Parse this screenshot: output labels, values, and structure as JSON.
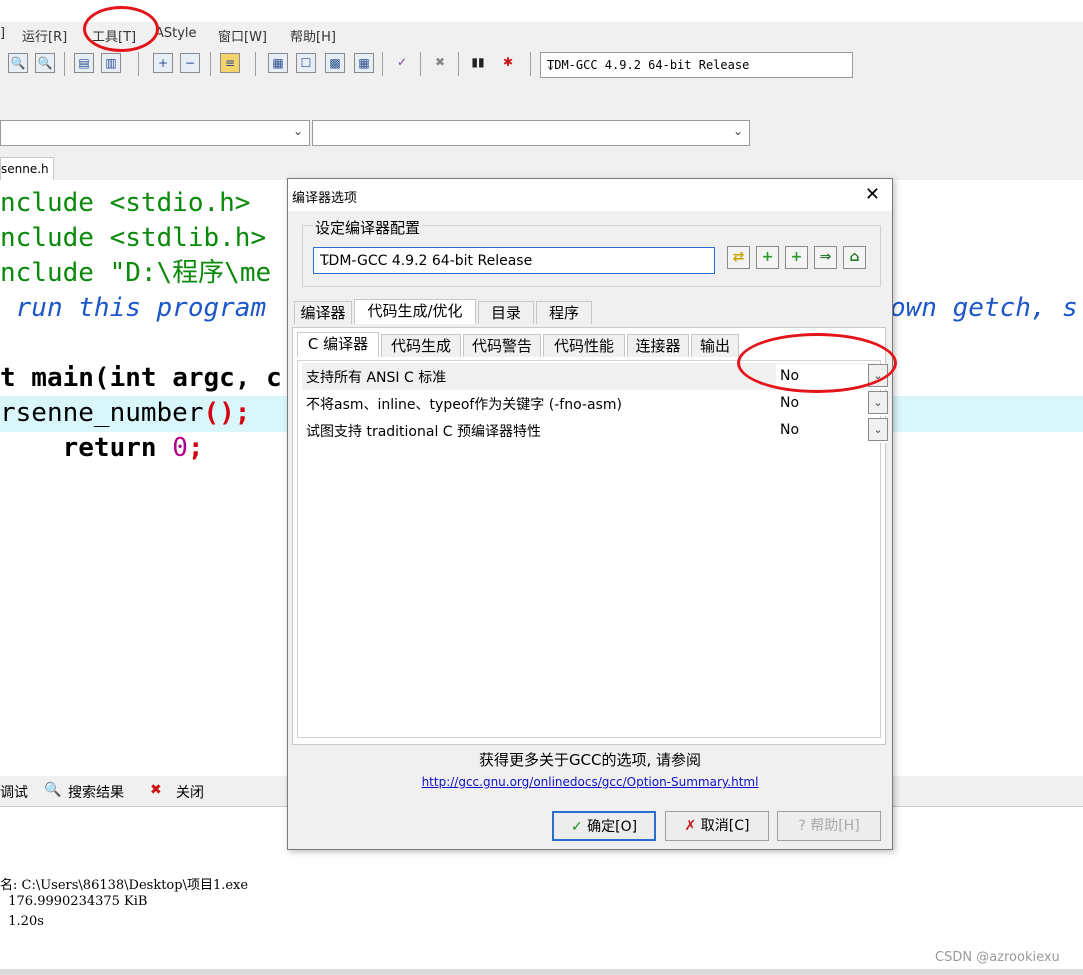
{
  "menu": {
    "items": [
      "]",
      "运行[R]",
      "工具[T]",
      "AStyle",
      "窗口[W]",
      "帮助[H]"
    ]
  },
  "toolbar": {
    "compiler": "TDM-GCC 4.9.2 64-bit Release"
  },
  "file_tab": "senne.h",
  "editor": {
    "lines": [
      "nclude <stdio.h>",
      "nclude <stdlib.h>",
      "nclude \"D:\\程序\\me",
      " run this program ",
      "own getch, s",
      "t main(",
      "int",
      " argc, c",
      "rsenne_number",
      "();",
      "    return ",
      "0",
      ";"
    ]
  },
  "dialog": {
    "title": "编译器选项",
    "group_label": "设定编译器配置",
    "config_value": "TDM-GCC 4.9.2 64-bit Release",
    "tabs": [
      "编译器",
      "代码生成/优化",
      "目录",
      "程序"
    ],
    "subtabs": [
      "C 编译器",
      "代码生成",
      "代码警告",
      "代码性能",
      "连接器",
      "输出"
    ],
    "options": [
      {
        "label": "支持所有 ANSI C 标准",
        "value": "No"
      },
      {
        "label": "不将asm、inline、typeof作为关键字 (-fno-asm)",
        "value": "No"
      },
      {
        "label": "试图支持 traditional C 预编译器特性",
        "value": "No"
      }
    ],
    "more_info": "获得更多关于GCC的选项, 请参阅",
    "link": "http://gcc.gnu.org/onlinedocs/gcc/Option-Summary.html",
    "ok": "确定[O]",
    "cancel": "取消[C]",
    "help": "帮助[H]"
  },
  "bottom": {
    "tabs": [
      "调试",
      "搜索结果",
      "关闭"
    ],
    "log": [
      "名: C:\\Users\\86138\\Desktop\\项目1.exe",
      "  176.9990234375 KiB",
      "  1.20s"
    ]
  },
  "watermark": "CSDN @azrookiexu",
  "colors": {
    "annotation": "#e4141b",
    "accent": "#2a6fcf",
    "highlight_line": "#d9f7fb"
  }
}
